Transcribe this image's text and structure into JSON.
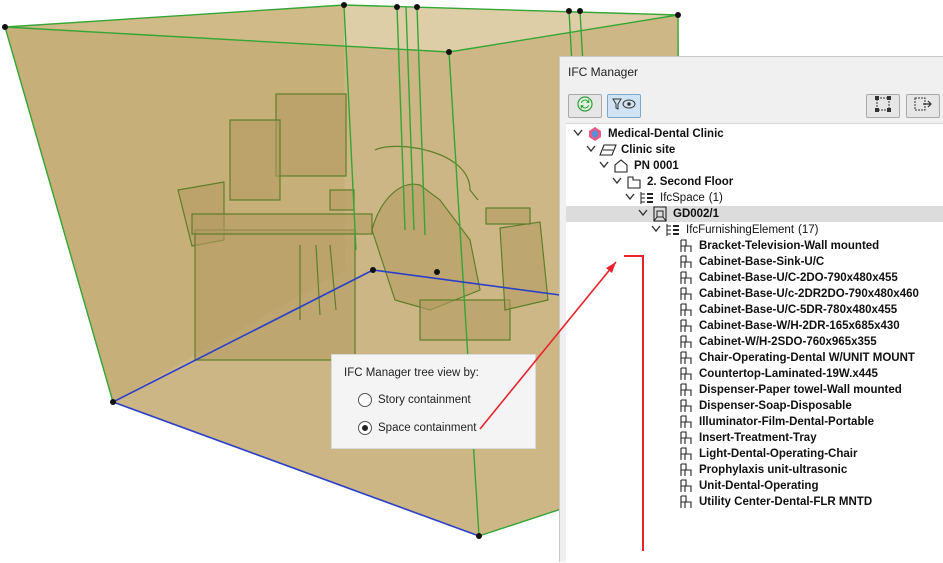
{
  "panel": {
    "title": "IFC Manager",
    "toolbar": {
      "refresh_icon": "refresh-icon",
      "filter_view_icon": "filter-eye-icon",
      "select_icon": "select-elements-icon",
      "export_icon": "export-icon"
    }
  },
  "tree": [
    {
      "label": "Medical-Dental Clinic",
      "count": "",
      "icon": "project-icon",
      "bold": true
    },
    {
      "label": "Clinic site",
      "count": "",
      "icon": "site-icon",
      "bold": true
    },
    {
      "label": "PN 0001",
      "count": "",
      "icon": "building-icon",
      "bold": true
    },
    {
      "label": "2. Second Floor",
      "count": "",
      "icon": "storey-icon",
      "bold": true
    },
    {
      "label": "IfcSpace",
      "count": "(1)",
      "icon": "class-icon",
      "bold": false
    },
    {
      "label": "GD002/1",
      "count": "",
      "icon": "space-icon",
      "bold": true
    },
    {
      "label": "IfcFurnishingElement",
      "count": "(17)",
      "icon": "class-icon",
      "bold": false
    },
    {
      "label": "Bracket-Television-Wall mounted",
      "count": "",
      "icon": "furniture-icon",
      "bold": true
    },
    {
      "label": "Cabinet-Base-Sink-U/C",
      "count": "",
      "icon": "furniture-icon",
      "bold": true
    },
    {
      "label": "Cabinet-Base-U/C-2DO-790x480x455",
      "count": "",
      "icon": "furniture-icon",
      "bold": true
    },
    {
      "label": "Cabinet-Base-U/c-2DR2DO-790x480x460",
      "count": "",
      "icon": "furniture-icon",
      "bold": true
    },
    {
      "label": "Cabinet-Base-U/C-5DR-780x480x455",
      "count": "",
      "icon": "furniture-icon",
      "bold": true
    },
    {
      "label": "Cabinet-Base-W/H-2DR-165x685x430",
      "count": "",
      "icon": "furniture-icon",
      "bold": true
    },
    {
      "label": "Cabinet-W/H-2SDO-760x965x355",
      "count": "",
      "icon": "furniture-icon",
      "bold": true
    },
    {
      "label": "Chair-Operating-Dental W/UNIT MOUNT",
      "count": "",
      "icon": "furniture-icon",
      "bold": true
    },
    {
      "label": "Countertop-Laminated-19W.x445",
      "count": "",
      "icon": "furniture-icon",
      "bold": true
    },
    {
      "label": "Dispenser-Paper towel-Wall mounted",
      "count": "",
      "icon": "furniture-icon",
      "bold": true
    },
    {
      "label": "Dispenser-Soap-Disposable",
      "count": "",
      "icon": "furniture-icon",
      "bold": true
    },
    {
      "label": "Illuminator-Film-Dental-Portable",
      "count": "",
      "icon": "furniture-icon",
      "bold": true
    },
    {
      "label": "Insert-Treatment-Tray",
      "count": "",
      "icon": "furniture-icon",
      "bold": true
    },
    {
      "label": "Light-Dental-Operating-Chair",
      "count": "",
      "icon": "furniture-icon",
      "bold": true
    },
    {
      "label": "Prophylaxis unit-ultrasonic",
      "count": "",
      "icon": "furniture-icon",
      "bold": true
    },
    {
      "label": "Unit-Dental-Operating",
      "count": "",
      "icon": "furniture-icon",
      "bold": true
    },
    {
      "label": "Utility Center-Dental-FLR MNTD",
      "count": "",
      "icon": "furniture-icon",
      "bold": true
    }
  ],
  "legend": {
    "title": "IFC Manager tree view by:",
    "options": [
      {
        "label": "Story containment",
        "selected": false
      },
      {
        "label": "Space containment",
        "selected": true
      }
    ]
  },
  "colors": {
    "space_fill": "#c8b07a",
    "space_edge": "#2e9e2e",
    "floor_edge": "#2b3fc8",
    "arrow": "#e8232b"
  }
}
